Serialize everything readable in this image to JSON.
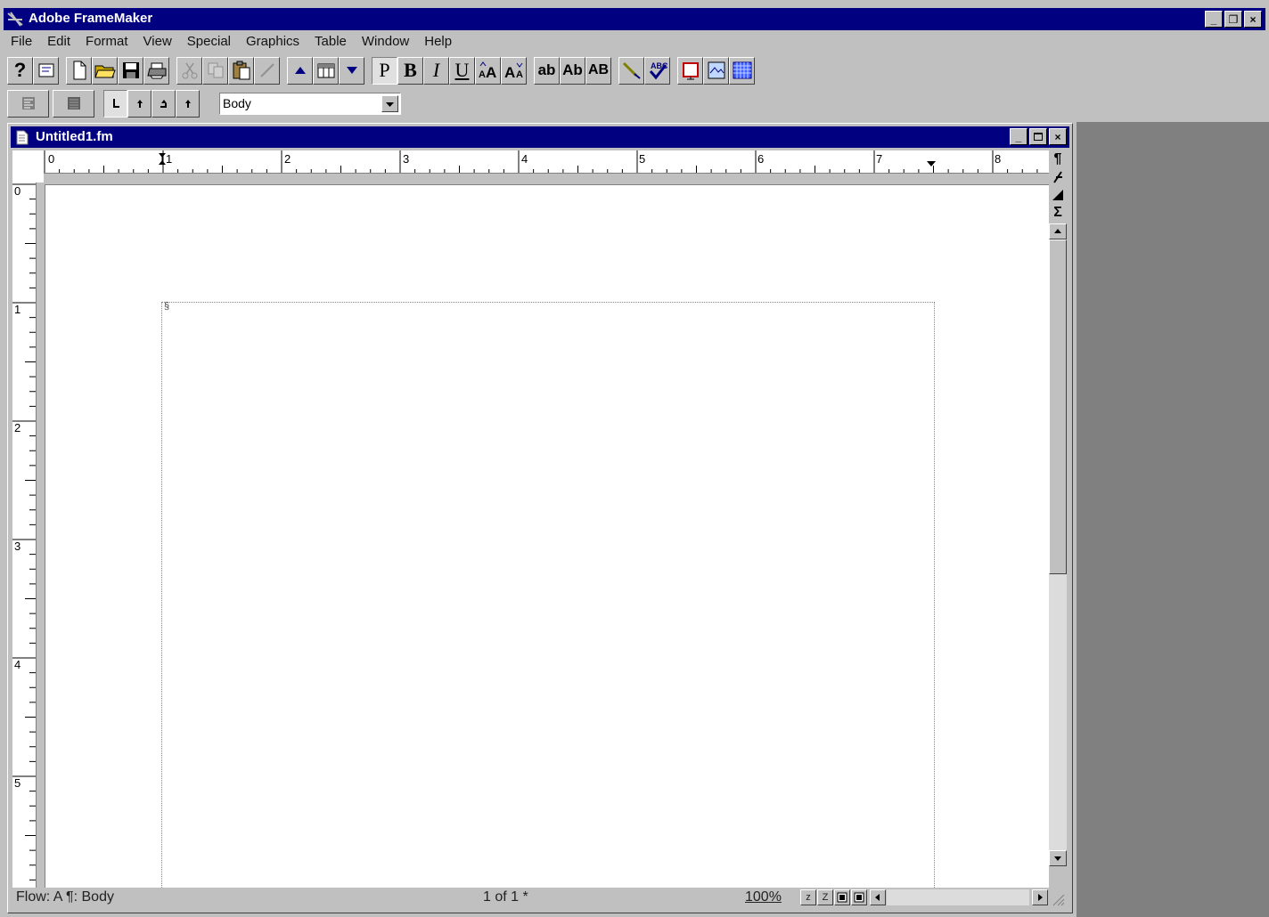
{
  "app": {
    "title": "Adobe FrameMaker"
  },
  "window_controls": {
    "minimize": "_",
    "restore": "❐",
    "close": "×"
  },
  "menu": [
    "File",
    "Edit",
    "Format",
    "View",
    "Special",
    "Graphics",
    "Table",
    "Window",
    "Help"
  ],
  "toolbar": {
    "help": "?",
    "plain": "P",
    "bold": "B",
    "italic": "I",
    "underline": "U",
    "lowercase": "ab",
    "initial_caps": "Ab",
    "uppercase": "AB"
  },
  "format_bar": {
    "paragraph_tag": "Body"
  },
  "document": {
    "title": "Untitled1.fm",
    "ruler_h_labels": [
      "0",
      "1",
      "2",
      "3",
      "4",
      "5",
      "6",
      "7",
      "8"
    ],
    "ruler_v_labels": [
      "0",
      "1",
      "2",
      "3",
      "4",
      "5"
    ],
    "end_of_flow": "§"
  },
  "side_tools": {
    "pilcrow": "¶",
    "equation": "Σ"
  },
  "status": {
    "flow": "Flow: A  ¶: Body",
    "page": "1 of 1 *",
    "zoom": "100%",
    "zoom_minus": "z",
    "zoom_plus": "Z"
  },
  "colors": {
    "titlebar": "#000080",
    "face": "#c0c0c0",
    "desktop": "#808080"
  }
}
